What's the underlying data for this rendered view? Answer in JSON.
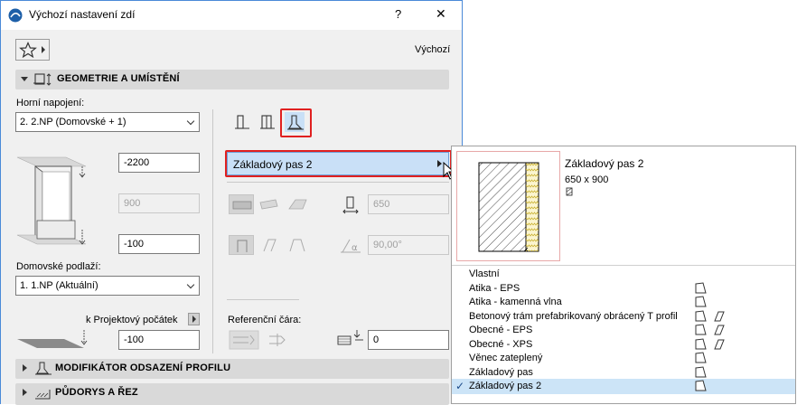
{
  "titlebar": {
    "title": "Výchozí nastavení zdí",
    "help_label": "?",
    "close_label": "✕"
  },
  "toolbar": {
    "preset_label": "Výchozí"
  },
  "sections": {
    "geometry_label": "GEOMETRIE A UMÍSTĚNÍ",
    "profile_modifier_label": "MODIFIKÁTOR ODSAZENÍ PROFILU",
    "plan_section_label": "PŮDORYS A ŘEZ"
  },
  "geometry": {
    "top_link_label": "Horní napojení:",
    "top_link_value": "2. 2.NP (Domovské + 1)",
    "top_offset": "-2200",
    "height": "900",
    "bottom_offset": "-100",
    "home_story_label": "Domovské podlaží:",
    "home_story_value": "1. 1.NP (Aktuální)",
    "to_project_zero_label": "k Projektový počátek",
    "project_zero_value": "-100",
    "profile_value": "Základový pas 2",
    "thickness": "650",
    "angle": "90,00°",
    "reference_line_label": "Referenční čára:",
    "ref_offset": "0"
  },
  "popup": {
    "preview_title": "Základový pas 2",
    "preview_size": "650 x 900",
    "items": [
      {
        "label": "Vlastní"
      },
      {
        "label": "Atika - EPS"
      },
      {
        "label": "Atika - kamenná vlna"
      },
      {
        "label": "Betonový trám prefabrikovaný obrácený T profil"
      },
      {
        "label": "Obecné - EPS"
      },
      {
        "label": "Obecné - XPS"
      },
      {
        "label": "Věnec zateplený"
      },
      {
        "label": "Základový pas"
      },
      {
        "label": "Základový pas 2"
      }
    ]
  },
  "colors": {
    "accent_red": "#e02020",
    "selection_blue": "#cce4f7",
    "section_header": "#d9d9d9"
  }
}
